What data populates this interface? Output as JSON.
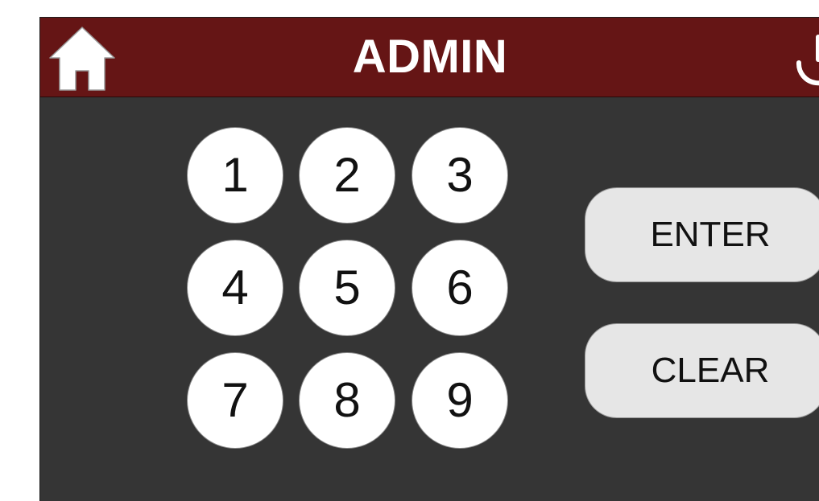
{
  "header": {
    "title": "ADMIN",
    "background_color": "#651515",
    "home_icon": "home-icon",
    "power_icon": "power-icon"
  },
  "keypad": {
    "keys": [
      "1",
      "2",
      "3",
      "4",
      "5",
      "6",
      "7",
      "8",
      "9"
    ]
  },
  "actions": {
    "enter_label": "ENTER",
    "clear_label": "CLEAR"
  },
  "colors": {
    "screen_background": "#353535",
    "key_background": "#ffffff",
    "action_background": "#e6e6e6"
  }
}
